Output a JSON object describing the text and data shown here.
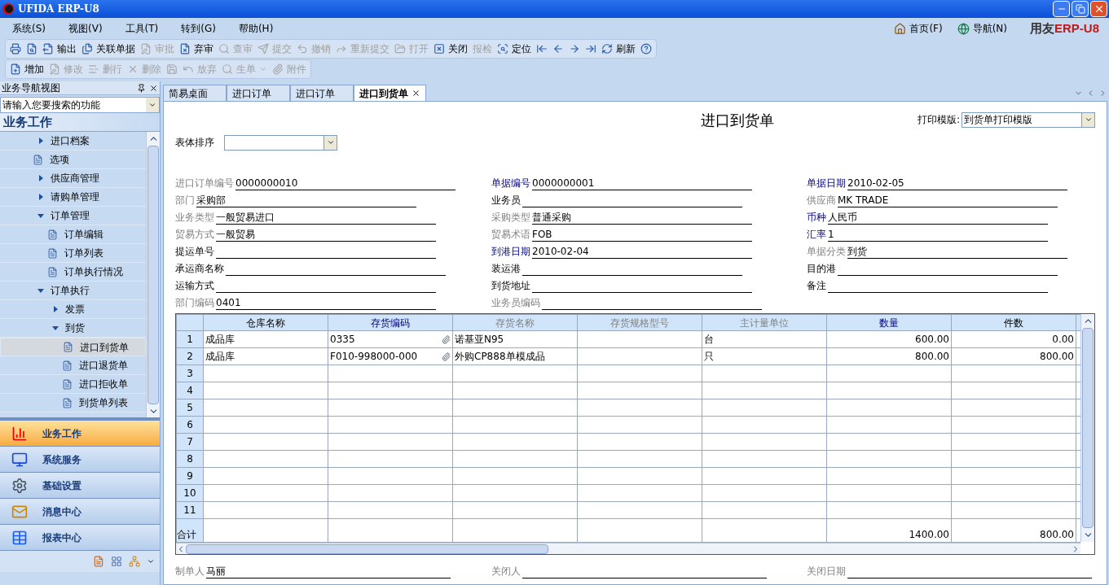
{
  "title_bar": {
    "title": "UFIDA ERP-U8"
  },
  "menu_bar": {
    "menus": [
      "系统(S)",
      "视图(V)",
      "工具(T)",
      "转到(G)",
      "帮助(H)"
    ],
    "links": [
      "首页(F)",
      "导航(N)"
    ],
    "logo": {
      "brand": "用友",
      "product": "ERP-U8"
    }
  },
  "toolbar_main": [
    {
      "disabled": false
    },
    {
      "disabled": false
    },
    {
      "label": "输出",
      "disabled": false
    },
    {
      "label": "关联单据",
      "disabled": false
    },
    {
      "label": "审批",
      "disabled": true
    },
    {
      "label": "弃审",
      "disabled": false
    },
    {
      "label": "查审",
      "disabled": true
    },
    {
      "label": "提交",
      "disabled": true
    },
    {
      "label": "撤销",
      "disabled": true
    },
    {
      "label": "重新提交",
      "disabled": true
    },
    {
      "label": "打开",
      "disabled": true
    },
    {
      "label": "关闭",
      "disabled": false
    },
    {
      "label": "报检",
      "disabled": true
    },
    {
      "label": "定位",
      "disabled": false
    },
    {
      "disabled": false
    },
    {
      "disabled": false
    },
    {
      "disabled": false
    },
    {
      "disabled": false
    },
    {
      "label": "刷新",
      "disabled": false
    },
    {
      "disabled": false
    }
  ],
  "toolbar_edit": [
    {
      "label": "增加",
      "disabled": false
    },
    {
      "label": "修改",
      "disabled": true
    },
    {
      "label": "删行",
      "disabled": true
    },
    {
      "label": "删除",
      "disabled": true
    },
    {
      "disabled": true
    },
    {
      "label": "放弃",
      "disabled": true
    },
    {
      "label": "生单",
      "disabled": true
    },
    {
      "label": "附件",
      "disabled": true
    }
  ],
  "nav_panel": {
    "title": "业务导航视图",
    "search": {
      "placeholder": "请输入您要搜索的功能"
    },
    "heading": "业务工作",
    "tree": [
      {
        "label": "进口档案",
        "kind": "folder",
        "expanded": false,
        "selected": false
      },
      {
        "label": "选项",
        "kind": "doc",
        "selected": false
      },
      {
        "label": "供应商管理",
        "kind": "folder",
        "expanded": false,
        "selected": false
      },
      {
        "label": "请购单管理",
        "kind": "folder",
        "expanded": false,
        "selected": false
      },
      {
        "label": "订单管理",
        "kind": "folder",
        "expanded": true,
        "selected": false,
        "children": [
          {
            "label": "订单编辑",
            "kind": "doc",
            "selected": false
          },
          {
            "label": "订单列表",
            "kind": "doc",
            "selected": false
          },
          {
            "label": "订单执行情况",
            "kind": "doc",
            "selected": false
          }
        ]
      },
      {
        "label": "订单执行",
        "kind": "folder",
        "expanded": true,
        "selected": false,
        "children": [
          {
            "label": "发票",
            "kind": "folder",
            "expanded": false,
            "selected": false
          },
          {
            "label": "到货",
            "kind": "folder",
            "expanded": true,
            "selected": false,
            "children": [
              {
                "label": "进口到货单",
                "kind": "doc",
                "selected": true
              },
              {
                "label": "进口退货单",
                "kind": "doc",
                "selected": false
              },
              {
                "label": "进口拒收单",
                "kind": "doc",
                "selected": false
              },
              {
                "label": "到货单列表",
                "kind": "doc",
                "selected": false
              }
            ]
          }
        ]
      }
    ],
    "sections": [
      {
        "label": "业务工作",
        "selected": true
      },
      {
        "label": "系统服务",
        "selected": false
      },
      {
        "label": "基础设置",
        "selected": false
      },
      {
        "label": "消息中心",
        "selected": false
      },
      {
        "label": "报表中心",
        "selected": false
      }
    ]
  },
  "tabs": [
    {
      "label": "简易桌面",
      "selected": false
    },
    {
      "label": "进口订单",
      "selected": false
    },
    {
      "label": "进口订单",
      "selected": false
    },
    {
      "label": "进口到货单",
      "selected": true
    }
  ],
  "document": {
    "title": "进口到货单",
    "print_template": {
      "label": "打印模版:",
      "value": "到货单打印模版"
    },
    "sort": {
      "label": "表体排序"
    },
    "fields": [
      {
        "label": "进口订单编号",
        "value": "0000000010",
        "kind": "locked"
      },
      {
        "label": "单据编号",
        "value": "0000000001",
        "kind": "required"
      },
      {
        "label": "单据日期",
        "value": "2010-02-05",
        "kind": "required"
      },
      {
        "label": "部门",
        "value": "采购部",
        "kind": "locked"
      },
      {
        "label": "业务员",
        "kind": "plain"
      },
      {
        "label": "供应商",
        "value": "MK TRADE",
        "kind": "locked"
      },
      {
        "label": "业务类型",
        "value": "一般贸易进口",
        "kind": "locked"
      },
      {
        "label": "采购类型",
        "value": "普通采购",
        "kind": "locked"
      },
      {
        "label": "币种",
        "value": "人民币",
        "kind": "required"
      },
      {
        "label": "贸易方式",
        "value": "一般贸易",
        "kind": "locked"
      },
      {
        "label": "贸易术语",
        "value": "FOB",
        "kind": "locked"
      },
      {
        "label": "汇率",
        "value": "1",
        "kind": "required"
      },
      {
        "label": "提运单号",
        "kind": "plain"
      },
      {
        "label": "到港日期",
        "value": "2010-02-04",
        "kind": "required"
      },
      {
        "label": "单据分类",
        "value": "到货",
        "kind": "locked"
      },
      {
        "label": "承运商名称",
        "kind": "plain"
      },
      {
        "label": "装运港",
        "kind": "plain"
      },
      {
        "label": "目的港",
        "kind": "plain"
      },
      {
        "label": "运输方式",
        "kind": "plain"
      },
      {
        "label": "到货地址",
        "kind": "plain"
      },
      {
        "label": "备注",
        "kind": "plain"
      },
      {
        "label": "部门编码",
        "value": "0401",
        "kind": "locked"
      },
      {
        "label": "业务员编码",
        "kind": "locked"
      }
    ],
    "table": {
      "columns": [
        {
          "label": "仓库名称",
          "kind": "plain"
        },
        {
          "label": "存货编码",
          "kind": "required"
        },
        {
          "label": "存货名称",
          "kind": "locked"
        },
        {
          "label": "存货规格型号",
          "kind": "locked"
        },
        {
          "label": "主计量单位",
          "kind": "locked"
        },
        {
          "label": "数量",
          "kind": "required"
        },
        {
          "label": "件数",
          "kind": "plain"
        }
      ],
      "rows": [
        {
          "number": "1",
          "warehouse": "成品库",
          "code": "0335",
          "name": "诺基亚N95",
          "unit": "台",
          "qty": "600.00",
          "pieces": "0.00"
        },
        {
          "number": "2",
          "warehouse": "成品库",
          "code": "F010-998000-000",
          "name": "外购CP888单模成品",
          "unit": "只",
          "qty": "800.00",
          "pieces": "800.00"
        },
        {
          "number": "3"
        },
        {
          "number": "4"
        },
        {
          "number": "5"
        },
        {
          "number": "6"
        },
        {
          "number": "7"
        },
        {
          "number": "8"
        },
        {
          "number": "9"
        },
        {
          "number": "10"
        },
        {
          "number": "11"
        }
      ],
      "total": {
        "label": "合计",
        "qty": "1400.00",
        "pieces": "800.00"
      }
    },
    "footer_fields": [
      {
        "label": "制单人",
        "value": "马丽",
        "kind": "locked"
      },
      {
        "label": "关闭人",
        "kind": "locked"
      },
      {
        "label": "关闭日期",
        "kind": "locked"
      }
    ]
  }
}
